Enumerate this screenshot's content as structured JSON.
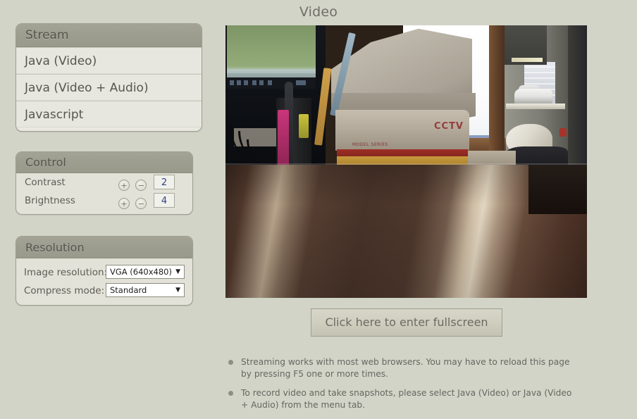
{
  "page": {
    "title": "Video",
    "background_color": "#d3d4c8"
  },
  "stream_panel": {
    "header": "Stream",
    "items": [
      {
        "label": "Java (Video)"
      },
      {
        "label": "Java (Video + Audio)"
      },
      {
        "label": "Javascript"
      }
    ]
  },
  "control_panel": {
    "header": "Control",
    "rows": [
      {
        "label": "Contrast",
        "value": "2",
        "plus": "+",
        "minus": "−"
      },
      {
        "label": "Brightness",
        "value": "4",
        "plus": "+",
        "minus": "−"
      }
    ]
  },
  "resolution_panel": {
    "header": "Resolution",
    "rows": [
      {
        "label": "Image resolution:",
        "value": "VGA (640x480)",
        "arrow": "▼"
      },
      {
        "label": "Compress mode:",
        "value": "Standard",
        "arrow": "▼"
      }
    ]
  },
  "video": {
    "cctv_label": "CCTV",
    "cctv_sublabel": "MODEL SERIES"
  },
  "fullscreen_button": {
    "label": "Click here to enter fullscreen"
  },
  "notes": [
    {
      "text": "Streaming works with most web browsers. You may have to reload this page by pressing F5 one or more times."
    },
    {
      "text": "To record video and take snapshots, please select Java (Video) or Java (Video + Audio) from the menu tab."
    }
  ]
}
